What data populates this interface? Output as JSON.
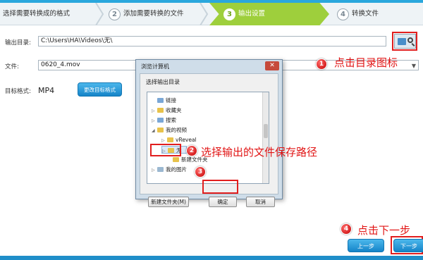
{
  "steps": [
    {
      "num": "",
      "label": "选择需要转换成的格式"
    },
    {
      "num": "2",
      "label": "添加需要转换的文件"
    },
    {
      "num": "3",
      "label": "输出设置"
    },
    {
      "num": "4",
      "label": "转换文件"
    }
  ],
  "form": {
    "output_dir_label": "输出目录:",
    "output_dir_value": "C:\\Users\\HA\\Videos\\无\\",
    "file_label": "文件:",
    "file_value": "0620_4.mov",
    "format_label": "目标格式:",
    "format_value": "MP4",
    "change_format_button": "更改目标格式"
  },
  "dialog": {
    "title": "浏览计算机",
    "subtitle": "选择输出目录",
    "close": "✕",
    "tree": [
      {
        "toggle": "",
        "icon": "ic-blue",
        "label": "链接"
      },
      {
        "toggle": "▷",
        "icon": "ic-yellow",
        "label": "收藏夹"
      },
      {
        "toggle": "▷",
        "icon": "ic-blue",
        "label": "搜索"
      },
      {
        "toggle": "◢",
        "icon": "ic-yellow",
        "label": "我的视频"
      },
      {
        "toggle": "▷",
        "icon": "ic-yellow",
        "label": "vReveal"
      },
      {
        "toggle": "▷",
        "icon": "ic-yellow",
        "label": "无"
      },
      {
        "toggle": "",
        "icon": "ic-yellow",
        "label": "新建文件夹"
      },
      {
        "toggle": "▷",
        "icon": "ic-photo",
        "label": "我的图片"
      }
    ],
    "new_folder_button": "新建文件夹(M)",
    "ok_button": "确定",
    "cancel_button": "取消"
  },
  "annotations": {
    "m1": "1",
    "a1": "点击目录图标",
    "m2": "2",
    "a2": "选择输出的文件保存路径",
    "m3": "3",
    "m4": "4",
    "a4": "点击下一步"
  },
  "nav": {
    "prev_button": "上一步",
    "next_button": "下一步"
  },
  "colors": {
    "active_step": "#9ecf3c",
    "accent_blue": "#1584c8",
    "annotation_red": "#e11414"
  }
}
